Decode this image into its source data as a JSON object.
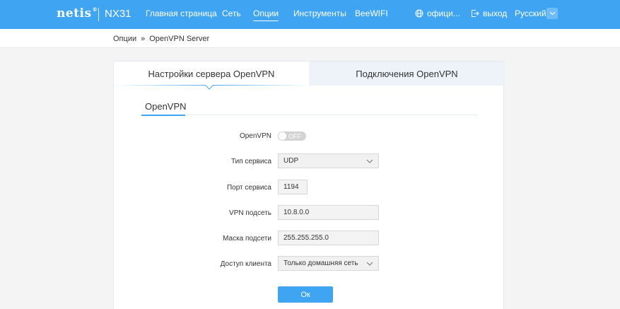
{
  "header": {
    "logo": "netis",
    "logo_tm": "®",
    "model": "NX31",
    "nav": [
      {
        "label": "Главная страница"
      },
      {
        "label": "Сеть"
      },
      {
        "label": "Опции",
        "active": true
      },
      {
        "label": "Инструменты"
      },
      {
        "label": "BeeWIFI"
      }
    ],
    "site_label": "офици...",
    "logout_label": "выход",
    "language": "Русский"
  },
  "breadcrumb": {
    "items": [
      "Опции",
      "OpenVPN Server"
    ],
    "separator": "»"
  },
  "tabs": {
    "server_settings": "Настройки сервера OpenVPN",
    "connections": "Подключения OpenVPN"
  },
  "subtab": "OpenVPN",
  "form": {
    "openvpn": {
      "label": "OpenVPN",
      "state": "OFF"
    },
    "service_type": {
      "label": "Тип сервиса",
      "value": "UDP"
    },
    "service_port": {
      "label": "Порт сервиса",
      "value": "1194"
    },
    "vpn_subnet": {
      "label": "VPN подсеть",
      "value": "10.8.0.0"
    },
    "subnet_mask": {
      "label": "Маска подсети",
      "value": "255.255.255.0"
    },
    "client_access": {
      "label": "Доступ клиента",
      "value": "Только домашняя сеть"
    }
  },
  "ok_label": "Ок",
  "colors": {
    "accent": "#3fa5f2",
    "inactive_tab": "#eef3f9",
    "toggle_off": "#d3d3d3"
  }
}
